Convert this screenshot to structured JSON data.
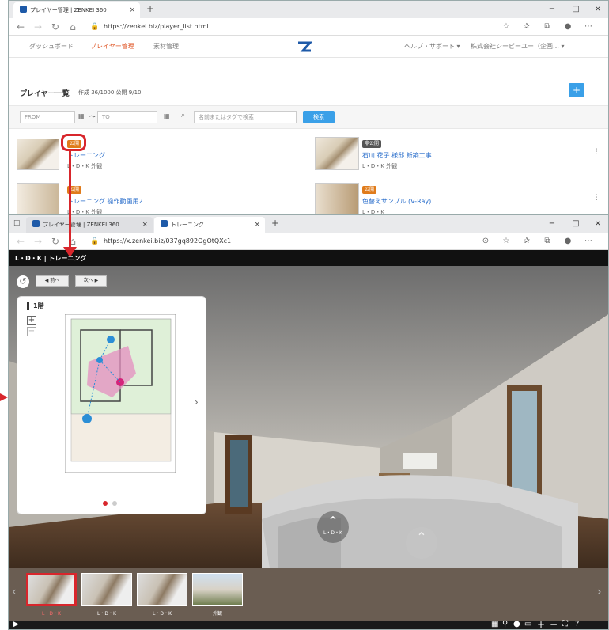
{
  "colors": {
    "accent_red": "#d8262c",
    "brand_blue": "#1e5aa8",
    "link_blue": "#2a6ecb",
    "orange": "#e07b1a",
    "dark": "#222222"
  },
  "top_window": {
    "tab_title": "プレイヤー管理 | ZENKEI 360",
    "new_tab": "+",
    "url": "https://zenkei.biz/player_list.html",
    "nav": {
      "dashboard": "ダッシュボード",
      "player": "プレイヤー管理",
      "material": "素材管理",
      "help": "ヘルプ・サポート ▾",
      "company": "株式会社シーピーユー（企画… ▾"
    },
    "list_title": "プレイヤー一覧",
    "list_counts": "作成 36/1000  公開 9/10",
    "add_button": "+",
    "filter": {
      "from_placeholder": "FROM",
      "tilde": "～",
      "to_placeholder": "TO",
      "keyword_placeholder": "名前またはタグで検索",
      "search_button": "検索"
    },
    "cards": [
      {
        "badge": "公開",
        "title": "トレーニング",
        "tags": "L・D・K 外観"
      },
      {
        "badge": "非公開",
        "title": "石川 花子 様邸 新築工事",
        "tags": "L・D・K 外観"
      },
      {
        "badge": "公開",
        "title": "トレーニング 操作動画用2",
        "tags": "L・D・K 外観"
      },
      {
        "badge": "公開",
        "title": "色替えサンプル (V-Ray)",
        "tags": "L・D・K"
      }
    ]
  },
  "bottom_window": {
    "tab1": "プレイヤー管理 | ZENKEI 360",
    "tab2": "トレーニング",
    "new_tab": "+",
    "url": "https://x.zenkei.biz/037gq892OgOtQXc1",
    "header_title": "L・D・K | トレーニング",
    "prev_button": "◀ 前へ",
    "next_button": "次へ ▶",
    "floor_label": "1階",
    "zoom_in": "+",
    "zoom_out": "−",
    "hotspot_label": "L・D・K",
    "thumbs": [
      "L・D・K",
      "L・D・K",
      "L・D・K",
      "外観"
    ]
  },
  "window_controls": {
    "minimize": "−",
    "maximize": "□",
    "close": "×"
  }
}
